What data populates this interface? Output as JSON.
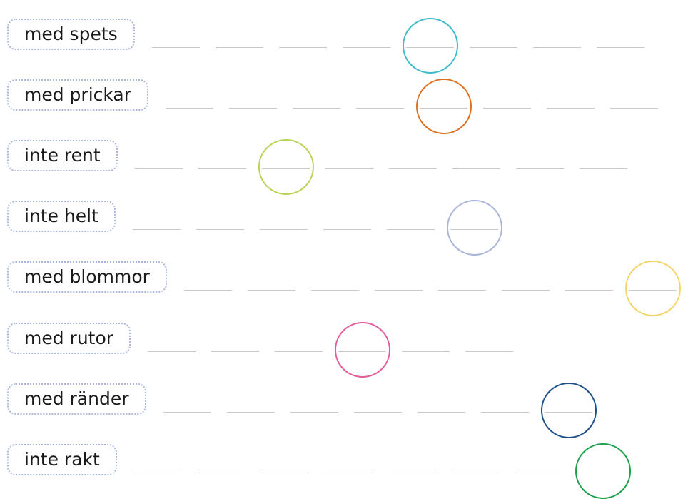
{
  "rows": [
    {
      "label": "med spets",
      "circle_color": "#3fbccb",
      "blanks": 8,
      "circle_slot": 4
    },
    {
      "label": "med prickar",
      "circle_color": "#e07020",
      "blanks": 8,
      "circle_slot": 4
    },
    {
      "label": "inte rent",
      "circle_color": "#b9d25a",
      "blanks": 8,
      "circle_slot": 2
    },
    {
      "label": "inte helt",
      "circle_color": "#aab5da",
      "blanks": 6,
      "circle_slot": 5
    },
    {
      "label": "med blommor",
      "circle_color": "#f5d567",
      "blanks": 8,
      "circle_slot": 7
    },
    {
      "label": "med rutor",
      "circle_color": "#e45a9a",
      "blanks": 6,
      "circle_slot": 3
    },
    {
      "label": "med ränder",
      "circle_color": "#1d4f86",
      "blanks": 7,
      "circle_slot": 6
    },
    {
      "label": "inte rakt",
      "circle_color": "#1aa14a",
      "blanks": 7,
      "circle_slot": 7
    }
  ]
}
